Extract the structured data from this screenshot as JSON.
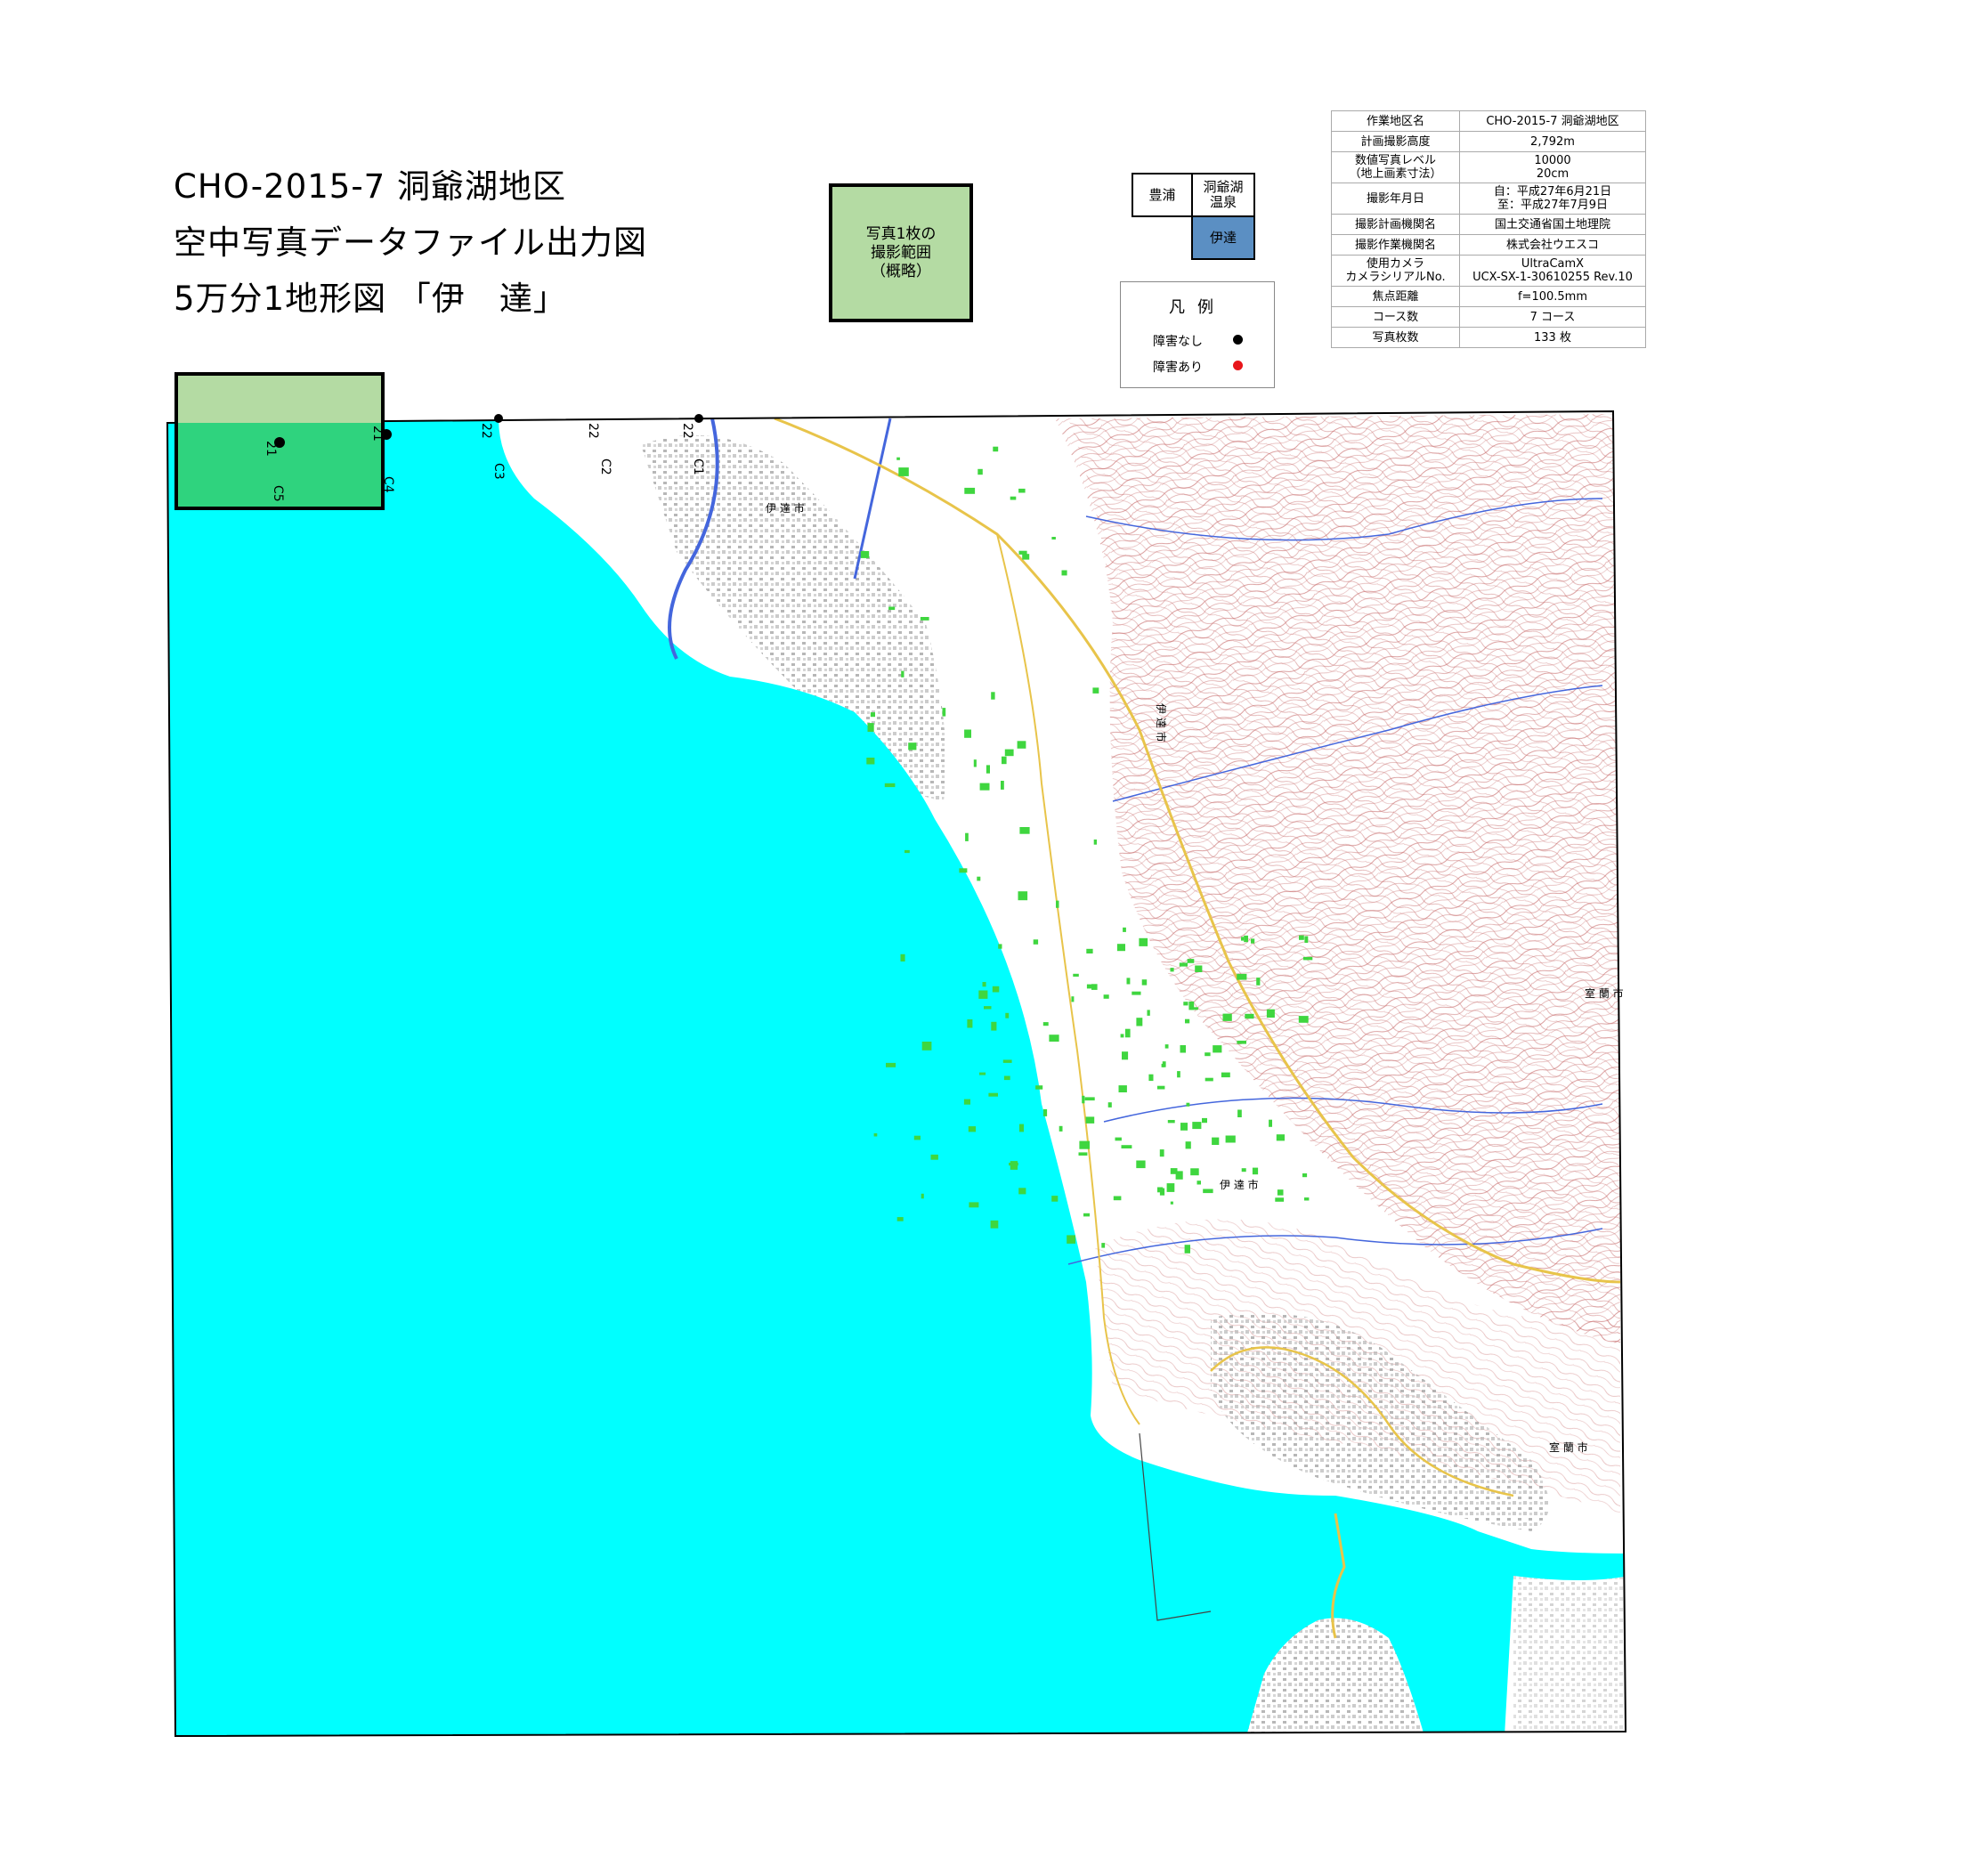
{
  "title": {
    "line1": "CHO-2015-7 洞爺湖地区",
    "line2": "空中写真データファイル出力図",
    "line3": "5万分1地形図 「伊　達」"
  },
  "extent_legend": {
    "line1": "写真1枚の",
    "line2": "撮影範囲",
    "line3": "（概略）"
  },
  "index_map": {
    "cells": [
      {
        "label": "豊浦"
      },
      {
        "label": "洞爺湖\n温泉"
      },
      {
        "label": "伊達"
      }
    ]
  },
  "legend": {
    "title": "凡例",
    "items": [
      {
        "label": "障害なし",
        "color": "#000000"
      },
      {
        "label": "障害あり",
        "color": "#e8161b"
      }
    ]
  },
  "info": [
    {
      "key": "作業地区名",
      "value": "CHO-2015-7 洞爺湖地区"
    },
    {
      "key": "計画撮影高度",
      "value": "2,792m"
    },
    {
      "key": "数値写真レベル\n（地上画素寸法）",
      "value": "10000\n20cm"
    },
    {
      "key": "撮影年月日",
      "value": "自：平成27年6月21日\n至：平成27年7月9日"
    },
    {
      "key": "撮影計画機関名",
      "value": "国土交通省国土地理院"
    },
    {
      "key": "撮影作業機関名",
      "value": "株式会社ウエスコ"
    },
    {
      "key": "使用カメラ\nカメラシリアルNo.",
      "value": "UltraCamX\nUCX-SX-1-30610255 Rev.10"
    },
    {
      "key": "焦点距離",
      "value": "f=100.5mm"
    },
    {
      "key": "コース数",
      "value": "7 コース"
    },
    {
      "key": "写真枚数",
      "value": "133 枚"
    }
  ],
  "map": {
    "sea_color": "#00ffff",
    "land_color": "#ffffff",
    "hill_color": "#c76a6a",
    "field_color": "#3fd63f",
    "road_color": "#e8c44a",
    "river_color": "#4466dd",
    "footprint_color": "#b4dba3",
    "footprint_overlap_color": "#2fd37e",
    "photo_points": [
      {
        "label": "21"
      },
      {
        "label": "21"
      }
    ],
    "course_labels": [
      "C5",
      "C4",
      "C3",
      "C2",
      "C1"
    ],
    "route_numbers": [
      "22",
      "22",
      "22"
    ],
    "place_labels": [
      "伊 達 市",
      "伊 達 市",
      "室 蘭 市",
      "室 蘭 市",
      "伊 達 市"
    ]
  }
}
